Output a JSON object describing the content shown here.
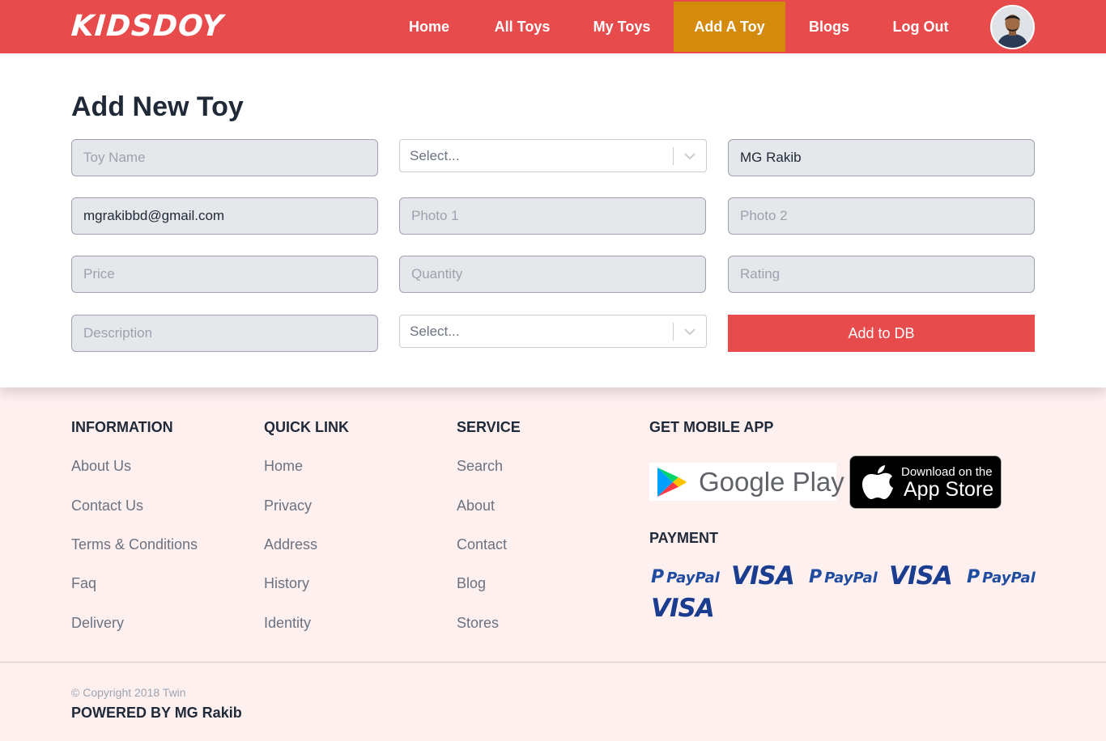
{
  "header": {
    "logo": "KIDSDOY",
    "nav": [
      {
        "label": "Home"
      },
      {
        "label": "All Toys"
      },
      {
        "label": "My Toys"
      },
      {
        "label": "Add A Toy",
        "active": true
      },
      {
        "label": "Blogs"
      },
      {
        "label": "Log Out"
      }
    ]
  },
  "form": {
    "title": "Add New Toy",
    "toy_name": {
      "placeholder": "Toy Name",
      "value": ""
    },
    "category_select": {
      "placeholder": "Select..."
    },
    "seller_name": {
      "value": "MG Rakib"
    },
    "seller_email": {
      "value": "mgrakibbd@gmail.com"
    },
    "photo1": {
      "placeholder": "Photo 1"
    },
    "photo2": {
      "placeholder": "Photo 2"
    },
    "price": {
      "placeholder": "Price"
    },
    "quantity": {
      "placeholder": "Quantity"
    },
    "rating": {
      "placeholder": "Rating"
    },
    "description": {
      "placeholder": "Description"
    },
    "subcategory_select": {
      "placeholder": "Select..."
    },
    "submit_label": "Add to DB"
  },
  "footer": {
    "information": {
      "heading": "INFORMATION",
      "links": [
        "About Us",
        "Contact Us",
        "Terms & Conditions",
        "Faq",
        "Delivery"
      ]
    },
    "quick_link": {
      "heading": "QUICK LINK",
      "links": [
        "Home",
        "Privacy",
        "Address",
        "History",
        "Identity"
      ]
    },
    "service": {
      "heading": "SERVICE",
      "links": [
        "Search",
        "About",
        "Contact",
        "Blog",
        "Stores"
      ]
    },
    "mobile_app": {
      "heading": "GET MOBILE APP",
      "google_play": "Google Play",
      "app_store_top": "Download on the",
      "app_store_bottom": "App Store"
    },
    "payment": {
      "heading": "PAYMENT",
      "logos": [
        "PayPal",
        "VISA",
        "PayPal",
        "VISA",
        "PayPal",
        "VISA"
      ]
    },
    "copyright": "© Copyright 2018 Twin",
    "powered_by": "POWERED BY MG Rakib"
  },
  "colors": {
    "brand": "#e84b4b",
    "active_nav": "#d48a0a",
    "footer_bg": "#fff0f0"
  }
}
